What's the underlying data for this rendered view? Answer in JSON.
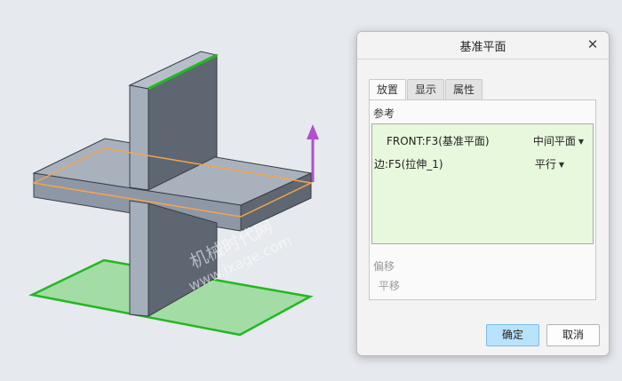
{
  "watermark": {
    "line1": "机械时代网",
    "line2": "www.jxage.com"
  },
  "dialog": {
    "title": "基准平面",
    "close_glyph": "✕",
    "tabs": [
      {
        "label": "放置",
        "active": true
      },
      {
        "label": "显示",
        "active": false
      },
      {
        "label": "属性",
        "active": false
      }
    ],
    "references_label": "参考",
    "references": [
      {
        "name": "FRONT:F3(基准平面)",
        "constraint": "中间平面"
      },
      {
        "name": "边:F5(拉伸_1)",
        "constraint": "平行"
      }
    ],
    "offset_label": "偏移",
    "offset_value": "平移",
    "ok_label": "确定",
    "cancel_label": "取消"
  },
  "colors": {
    "selection_green": "#22b822",
    "plane_fill": "#96d996",
    "datum_orange": "#f5a54a",
    "arrow_purple": "#b04fd0",
    "primary_button": "#b9e2fb",
    "reference_list_bg": "#e8f8dc"
  }
}
